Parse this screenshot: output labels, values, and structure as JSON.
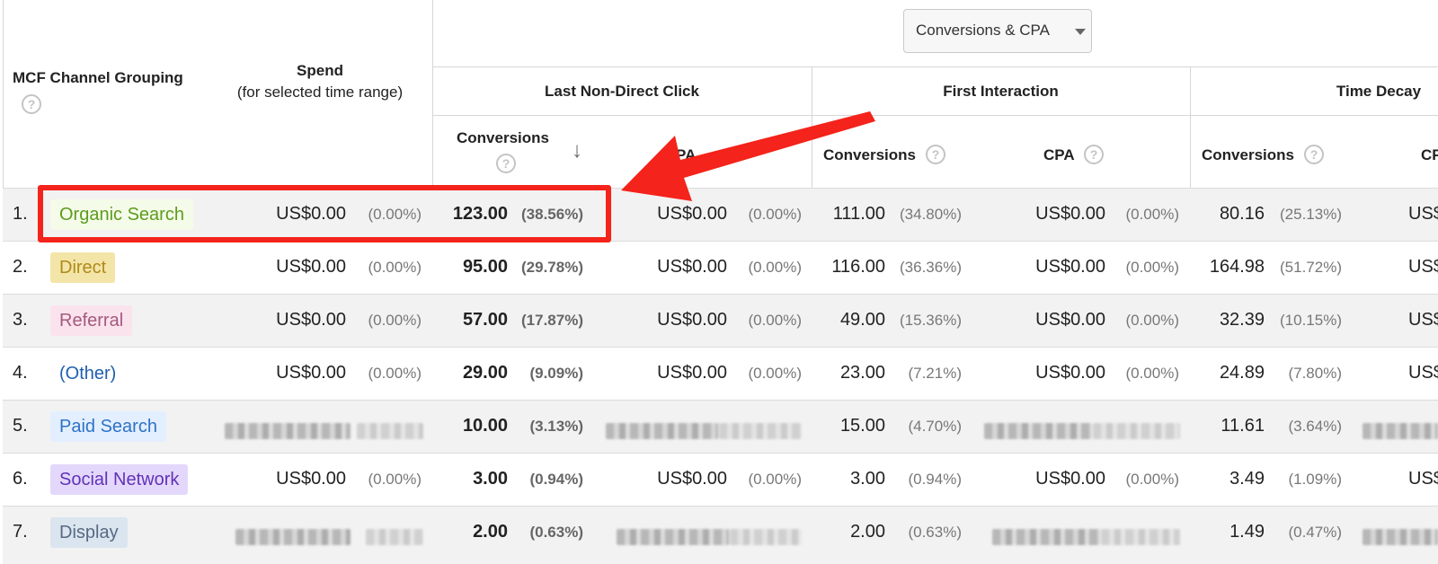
{
  "header": {
    "channel_label": "MCF Channel Grouping",
    "spend_label": "Spend",
    "spend_sub": "(for selected time range)",
    "dropdown_label": "Conversions & CPA",
    "groups": [
      "Last Non-Direct Click",
      "First Interaction",
      "Time Decay"
    ],
    "metric_conversions": "Conversions",
    "metric_cpa": "CPA",
    "metric_cpa_partial": "PA",
    "metric_cp_partial": "CP",
    "help_glyph": "?",
    "sort_glyph": "↓"
  },
  "colors": {
    "highlight_box": "#f4231b",
    "arrow": "#f4231b",
    "row_alt": "#f2f2f2",
    "sorted_column": "#ebebeb"
  },
  "icons": {
    "help": "help-circle-icon",
    "sort": "sort-descending-arrow-icon",
    "dropdown": "caret-down-icon"
  },
  "rows": [
    {
      "rank": "1.",
      "channel": "Organic Search",
      "spend": "US$0.00",
      "spend_pct": "(0.00%)",
      "lndc_conv": "123.00",
      "lndc_conv_pct": "(38.56%)",
      "lndc_cpa": "US$0.00",
      "lndc_cpa_pct": "(0.00%)",
      "fi_conv": "111.00",
      "fi_conv_pct": "(34.80%)",
      "fi_cpa": "US$0.00",
      "fi_cpa_pct": "(0.00%)",
      "td_conv": "80.16",
      "td_conv_pct": "(25.13%)",
      "td_cpa_partial": "US$"
    },
    {
      "rank": "2.",
      "channel": "Direct",
      "spend": "US$0.00",
      "spend_pct": "(0.00%)",
      "lndc_conv": "95.00",
      "lndc_conv_pct": "(29.78%)",
      "lndc_cpa": "US$0.00",
      "lndc_cpa_pct": "(0.00%)",
      "fi_conv": "116.00",
      "fi_conv_pct": "(36.36%)",
      "fi_cpa": "US$0.00",
      "fi_cpa_pct": "(0.00%)",
      "td_conv": "164.98",
      "td_conv_pct": "(51.72%)",
      "td_cpa_partial": "US$"
    },
    {
      "rank": "3.",
      "channel": "Referral",
      "spend": "US$0.00",
      "spend_pct": "(0.00%)",
      "lndc_conv": "57.00",
      "lndc_conv_pct": "(17.87%)",
      "lndc_cpa": "US$0.00",
      "lndc_cpa_pct": "(0.00%)",
      "fi_conv": "49.00",
      "fi_conv_pct": "(15.36%)",
      "fi_cpa": "US$0.00",
      "fi_cpa_pct": "(0.00%)",
      "td_conv": "32.39",
      "td_conv_pct": "(10.15%)",
      "td_cpa_partial": "US$"
    },
    {
      "rank": "4.",
      "channel": "(Other)",
      "spend": "US$0.00",
      "spend_pct": "(0.00%)",
      "lndc_conv": "29.00",
      "lndc_conv_pct": "(9.09%)",
      "lndc_cpa": "US$0.00",
      "lndc_cpa_pct": "(0.00%)",
      "fi_conv": "23.00",
      "fi_conv_pct": "(7.21%)",
      "fi_cpa": "US$0.00",
      "fi_cpa_pct": "(0.00%)",
      "td_conv": "24.89",
      "td_conv_pct": "(7.80%)",
      "td_cpa_partial": "US$"
    },
    {
      "rank": "5.",
      "channel": "Paid Search",
      "spend": "",
      "spend_pct": "",
      "lndc_conv": "10.00",
      "lndc_conv_pct": "(3.13%)",
      "lndc_cpa": "",
      "lndc_cpa_pct": "",
      "fi_conv": "15.00",
      "fi_conv_pct": "(4.70%)",
      "fi_cpa": "",
      "fi_cpa_pct": "",
      "td_conv": "11.61",
      "td_conv_pct": "(3.64%)",
      "td_cpa_partial": ""
    },
    {
      "rank": "6.",
      "channel": "Social Network",
      "spend": "US$0.00",
      "spend_pct": "(0.00%)",
      "lndc_conv": "3.00",
      "lndc_conv_pct": "(0.94%)",
      "lndc_cpa": "US$0.00",
      "lndc_cpa_pct": "(0.00%)",
      "fi_conv": "3.00",
      "fi_conv_pct": "(0.94%)",
      "fi_cpa": "US$0.00",
      "fi_cpa_pct": "(0.00%)",
      "td_conv": "3.49",
      "td_conv_pct": "(1.09%)",
      "td_cpa_partial": "US$"
    },
    {
      "rank": "7.",
      "channel": "Display",
      "spend": "",
      "spend_pct": "",
      "lndc_conv": "2.00",
      "lndc_conv_pct": "(0.63%)",
      "lndc_cpa": "",
      "lndc_cpa_pct": "",
      "fi_conv": "2.00",
      "fi_conv_pct": "(0.63%)",
      "fi_cpa": "",
      "fi_cpa_pct": "",
      "td_conv": "1.49",
      "td_conv_pct": "(0.47%)",
      "td_cpa_partial": ""
    }
  ]
}
